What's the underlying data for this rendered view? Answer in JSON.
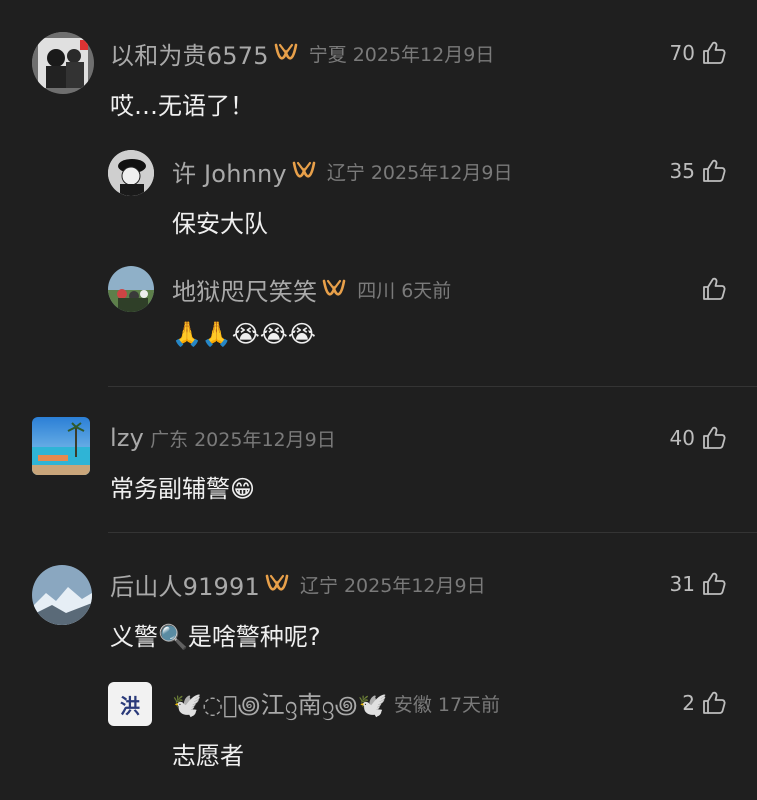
{
  "comments": [
    {
      "user": "以和为贵6575",
      "location": "宁夏",
      "date": "2025年12月9日",
      "likes": "70",
      "text": "哎…无语了！",
      "badge": true
    },
    {
      "user": "许 Johnny",
      "location": "辽宁",
      "date": "2025年12月9日",
      "likes": "35",
      "text": "保安大队",
      "badge": true
    },
    {
      "user": "地狱咫尺笑笑",
      "location": "四川",
      "date": "6天前",
      "likes": "",
      "text": "🙏🙏😭😭😭",
      "badge": true
    },
    {
      "user": "lzy",
      "location": "广东",
      "date": "2025年12月9日",
      "likes": "40",
      "text": "常务副辅警😁",
      "badge": false
    },
    {
      "user": "后山人91991",
      "location": "辽宁",
      "date": "2025年12月9日",
      "likes": "31",
      "text": "义警🔍是啥警种呢?",
      "badge": true
    },
    {
      "user": "🕊️◌᪲꩜江ᦋ南ᦋ꩜🕊️",
      "location": "安徽",
      "date": "17天前",
      "likes": "2",
      "text": "志愿者",
      "badge": false,
      "avatar_text": "洪"
    }
  ],
  "icons": {
    "like": "thumbs-up-icon",
    "badge": "vip-badge-icon"
  },
  "colors": {
    "background": "#1f1f1f",
    "badge": "#e8a04a",
    "username": "#a9a9a9",
    "meta": "#7a7a7a"
  }
}
